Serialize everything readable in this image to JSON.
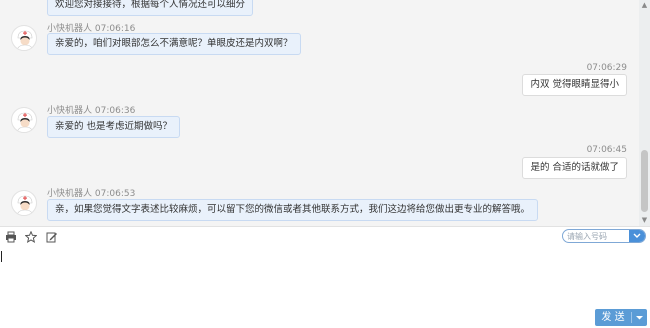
{
  "chat": {
    "messages": [
      {
        "side": "bot",
        "sender": "",
        "time": "",
        "text": "欢迎您对接接待，根据每个人情况还可以细分"
      },
      {
        "side": "bot",
        "sender": "小快机器人",
        "time": "07:06:16",
        "text": "亲爱的，咱们对眼部怎么不满意呢？单眼皮还是内双啊？"
      },
      {
        "side": "user",
        "time": "07:06:29",
        "text": "内双 觉得眼睛显得小"
      },
      {
        "side": "bot",
        "sender": "小快机器人",
        "time": "07:06:36",
        "text": "亲爱的 也是考虑近期做吗？"
      },
      {
        "side": "user",
        "time": "07:06:45",
        "text": "是的 合适的话就做了"
      },
      {
        "side": "bot",
        "sender": "小快机器人",
        "time": "07:06:53",
        "text": "亲，如果您觉得文字表述比较麻烦，可以留下您的微信或者其他联系方式，我们这边将给您做出更专业的解答哦。"
      }
    ]
  },
  "toolbar": {
    "icons": [
      "print-icon",
      "star-icon",
      "edit-icon"
    ],
    "search_placeholder": "请输入号码"
  },
  "composer": {
    "value": "",
    "send_label": "发 送"
  },
  "colors": {
    "bot_bubble": "#e9f1fb",
    "bot_bubble_border": "#c8daf2",
    "user_bubble": "#ffffff",
    "send_button": "#5b9cd6",
    "search_border": "#7fa8d6"
  }
}
